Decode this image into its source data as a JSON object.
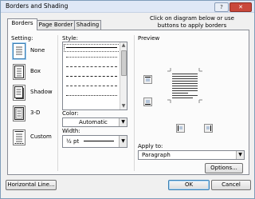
{
  "window": {
    "title": "Borders and Shading",
    "help_glyph": "?",
    "close_glyph": "✕"
  },
  "tabs": [
    {
      "label": "Borders",
      "active": true
    },
    {
      "label": "Page Border",
      "active": false
    },
    {
      "label": "Shading",
      "active": false
    }
  ],
  "setting": {
    "label": "Setting:",
    "options": [
      {
        "label": "None",
        "selected": true
      },
      {
        "label": "Box",
        "selected": false
      },
      {
        "label": "Shadow",
        "selected": false
      },
      {
        "label": "3-D",
        "selected": false
      },
      {
        "label": "Custom",
        "selected": false
      }
    ]
  },
  "style": {
    "label": "Style:"
  },
  "color": {
    "label": "Color:",
    "value": "Automatic"
  },
  "width": {
    "label": "Width:",
    "value": "½ pt"
  },
  "preview": {
    "label": "Preview",
    "instruction": "Click on diagram below or use buttons to apply borders"
  },
  "apply_to": {
    "label": "Apply to:",
    "value": "Paragraph"
  },
  "buttons": {
    "options": "Options...",
    "horizontal_line": "Horizontal Line...",
    "ok": "OK",
    "cancel": "Cancel"
  },
  "colors": {
    "accent": "#3c7fb1",
    "panel": "#fbfbfb",
    "titlebar": "#dfe8f6",
    "close": "#c9483b"
  }
}
